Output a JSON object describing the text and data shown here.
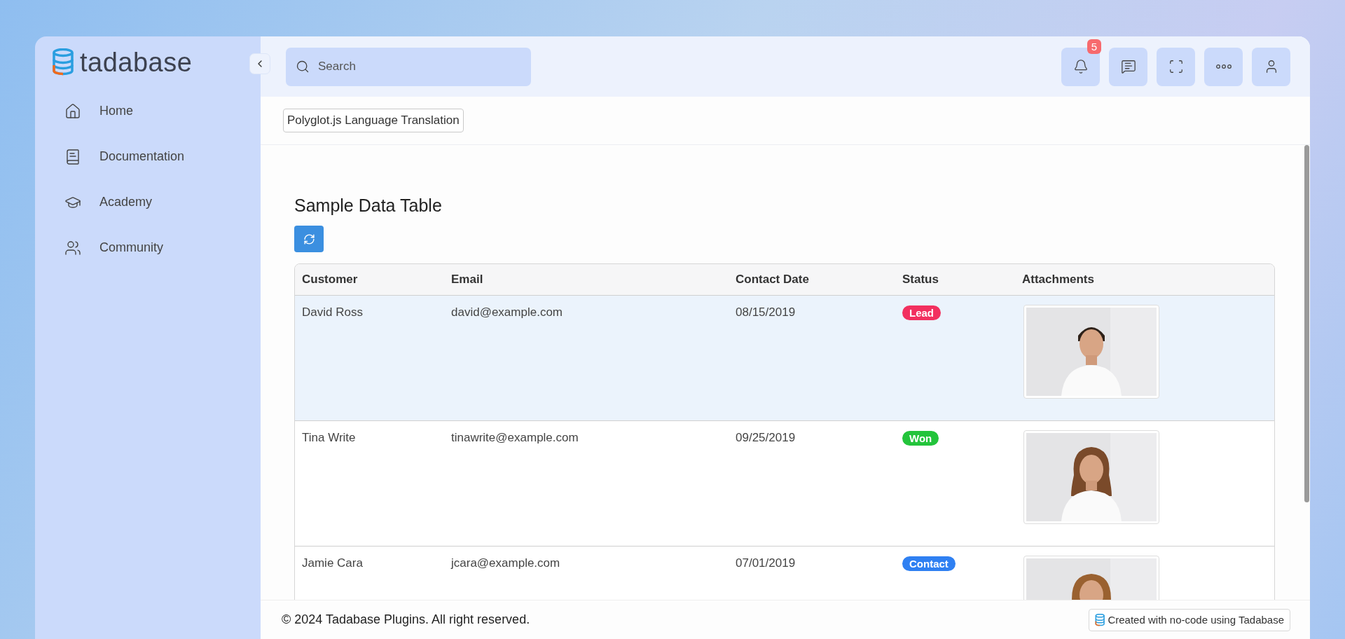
{
  "brand": {
    "name": "tadabase"
  },
  "sidebar": {
    "items": [
      {
        "label": "Home",
        "kind": "home"
      },
      {
        "label": "Documentation",
        "kind": "book"
      },
      {
        "label": "Academy",
        "kind": "cap"
      },
      {
        "label": "Community",
        "kind": "people"
      }
    ]
  },
  "header": {
    "search": {
      "placeholder": "Search"
    },
    "buttons": [
      {
        "kind": "bell",
        "badge": "5"
      },
      {
        "kind": "chat"
      },
      {
        "kind": "fullscreen"
      },
      {
        "kind": "more"
      },
      {
        "kind": "user"
      }
    ]
  },
  "page_button": "Polyglot.js Language Translation",
  "section_title": "Sample Data Table",
  "table": {
    "columns": [
      "Customer",
      "Email",
      "Contact Date",
      "Status",
      "Attachments"
    ],
    "rows": [
      {
        "customer": "David Ross",
        "email": "david@example.com",
        "contact_date": "08/15/2019",
        "status": {
          "label": "Lead",
          "color": "#f2305f"
        },
        "highlighted": true
      },
      {
        "customer": "Tina Write",
        "email": "tinawrite@example.com",
        "contact_date": "09/25/2019",
        "status": {
          "label": "Won",
          "color": "#23c43b"
        },
        "highlighted": false
      },
      {
        "customer": "Jamie Cara",
        "email": "jcara@example.com",
        "contact_date": "07/01/2019",
        "status": {
          "label": "Contact",
          "color": "#2f80f2"
        },
        "highlighted": false
      }
    ]
  },
  "footer": {
    "copyright": "© 2024 Tadabase Plugins. All right reserved.",
    "badge": "Created with no-code using Tadabase"
  }
}
